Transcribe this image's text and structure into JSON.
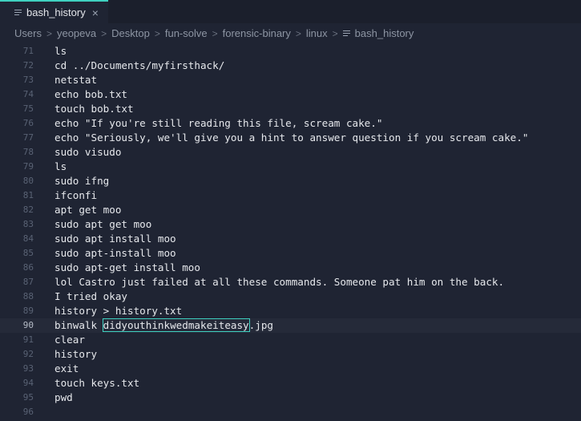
{
  "tab": {
    "title": "bash_history",
    "close_glyph": "×",
    "icon": "file-lines-icon"
  },
  "breadcrumb": {
    "items": [
      "Users",
      "yeopeva",
      "Desktop",
      "fun-solve",
      "forensic-binary",
      "linux",
      "bash_history"
    ],
    "separator": ">"
  },
  "editor": {
    "current_line": 90,
    "lines": [
      {
        "num": "71",
        "text": "ls"
      },
      {
        "num": "72",
        "text": "cd ../Documents/myfirsthack/"
      },
      {
        "num": "73",
        "text": "netstat"
      },
      {
        "num": "74",
        "text": "echo bob.txt"
      },
      {
        "num": "75",
        "text": "touch bob.txt"
      },
      {
        "num": "76",
        "text": "echo \"If you're still reading this file, scream cake.\""
      },
      {
        "num": "77",
        "text": "echo \"Seriously, we'll give you a hint to answer question if you scream cake.\""
      },
      {
        "num": "78",
        "text": "sudo visudo"
      },
      {
        "num": "79",
        "text": "ls"
      },
      {
        "num": "80",
        "text": "sudo ifng"
      },
      {
        "num": "81",
        "text": "ifconfi"
      },
      {
        "num": "82",
        "text": "apt get moo"
      },
      {
        "num": "83",
        "text": "sudo apt get moo"
      },
      {
        "num": "84",
        "text": "sudo apt install moo"
      },
      {
        "num": "85",
        "text": "sudo apt-install moo"
      },
      {
        "num": "86",
        "text": "sudo apt-get install moo"
      },
      {
        "num": "87",
        "text": "lol Castro just failed at all these commands. Someone pat him on the back."
      },
      {
        "num": "88",
        "text": "I tried okay"
      },
      {
        "num": "89",
        "text": "history > history.txt"
      },
      {
        "num": "90",
        "text": "binwalk ",
        "selected": "didyouthinkwedmakeiteasy",
        "after": ".jpg"
      },
      {
        "num": "91",
        "text": "clear"
      },
      {
        "num": "92",
        "text": "history"
      },
      {
        "num": "93",
        "text": "exit"
      },
      {
        "num": "94",
        "text": "touch keys.txt"
      },
      {
        "num": "95",
        "text": "pwd"
      },
      {
        "num": "96",
        "text": ""
      }
    ]
  },
  "colors": {
    "background": "#1f2433",
    "accent": "#3fd0c0",
    "text": "#e6e8ec",
    "gutter": "#596274"
  }
}
